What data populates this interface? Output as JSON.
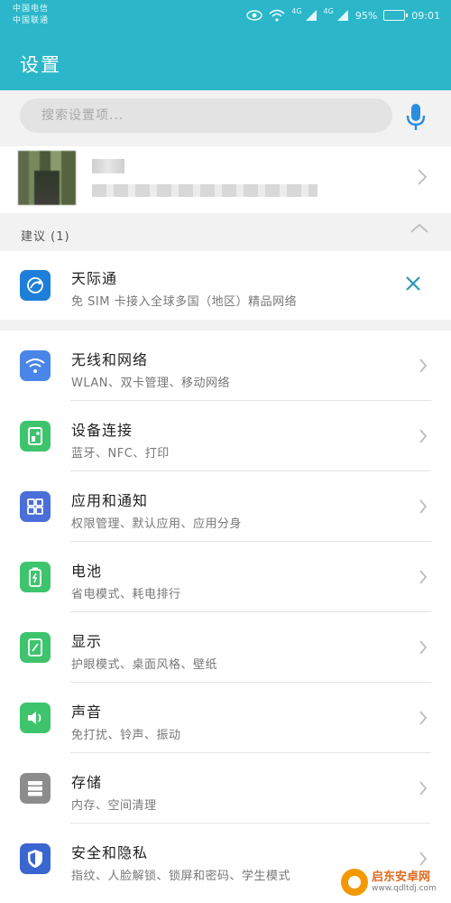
{
  "status": {
    "carrier1": "中国电信",
    "carrier2": "中国联通",
    "net1": "4G",
    "net2": "4G",
    "battery": "95%",
    "time": "09:01"
  },
  "app": {
    "title": "设置"
  },
  "search": {
    "placeholder": "搜索设置项..."
  },
  "account": {
    "name_blurred": true
  },
  "suggestions": {
    "header": "建议 (1)",
    "item": {
      "title": "天际通",
      "subtitle": "免 SIM 卡接入全球多国（地区）精品网络",
      "icon": "globe-route-icon"
    }
  },
  "settings": [
    {
      "id": "wireless",
      "title": "无线和网络",
      "subtitle": "WLAN、双卡管理、移动网络",
      "icon": "wifi-icon",
      "color": "#4a86e8"
    },
    {
      "id": "device",
      "title": "设备连接",
      "subtitle": "蓝牙、NFC、打印",
      "icon": "device-connect-icon",
      "color": "#3ec46d"
    },
    {
      "id": "apps",
      "title": "应用和通知",
      "subtitle": "权限管理、默认应用、应用分身",
      "icon": "apps-grid-icon",
      "color": "#4a6fd8"
    },
    {
      "id": "battery",
      "title": "电池",
      "subtitle": "省电模式、耗电排行",
      "icon": "battery-icon",
      "color": "#3ec46d"
    },
    {
      "id": "display",
      "title": "显示",
      "subtitle": "护眼模式、桌面风格、壁纸",
      "icon": "display-icon",
      "color": "#3ec46d"
    },
    {
      "id": "sound",
      "title": "声音",
      "subtitle": "免打扰、铃声、振动",
      "icon": "speaker-icon",
      "color": "#3ec46d"
    },
    {
      "id": "storage",
      "title": "存储",
      "subtitle": "内存、空间清理",
      "icon": "storage-icon",
      "color": "#8c8c8c"
    },
    {
      "id": "security",
      "title": "安全和隐私",
      "subtitle": "指纹、人脸解锁、锁屏和密码、学生模式",
      "icon": "shield-icon",
      "color": "#3a66d0"
    }
  ],
  "watermark": {
    "name": "启东安卓网",
    "url": "www.qdltdj.com"
  }
}
